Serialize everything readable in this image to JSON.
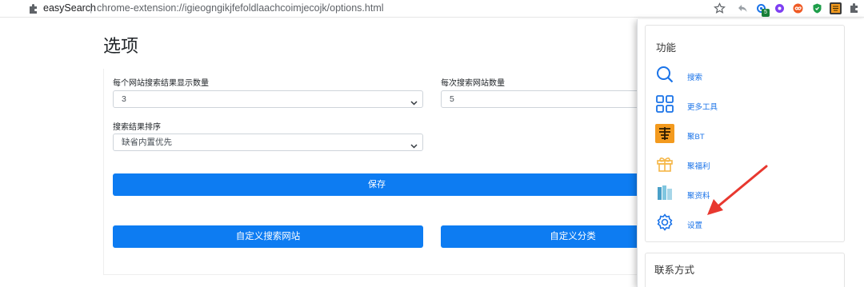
{
  "browser": {
    "site_name": "easySearch",
    "separator": "|",
    "url": "chrome-extension://igieogngikjfefoldlaachcoimjecojk/options.html",
    "badge_count": "5"
  },
  "page": {
    "title": "选项",
    "results_per_site_label": "每个网站搜索结果显示数量",
    "results_per_site_value": "3",
    "sites_per_search_label": "每次搜索网站数量",
    "sites_per_search_value": "5",
    "sort_label": "搜索结果排序",
    "sort_value": "缺省内置优先",
    "save_button": "保存",
    "custom_sites_button": "自定义搜索网站",
    "custom_category_button": "自定义分类"
  },
  "popup": {
    "functions_heading": "功能",
    "items": [
      {
        "label": "搜索",
        "icon": "search-icon"
      },
      {
        "label": "更多工具",
        "icon": "grid-icon"
      },
      {
        "label": "聚BT",
        "icon": "ju-logo-icon"
      },
      {
        "label": "聚福利",
        "icon": "gift-icon"
      },
      {
        "label": "聚资料",
        "icon": "books-icon"
      },
      {
        "label": "设置",
        "icon": "gear-icon"
      }
    ],
    "contact_heading": "联系方式"
  },
  "colors": {
    "primary": "#0d7cf2",
    "link": "#1a73e8",
    "arrow": "#e8382f",
    "ju_orange": "#f39a1e"
  }
}
